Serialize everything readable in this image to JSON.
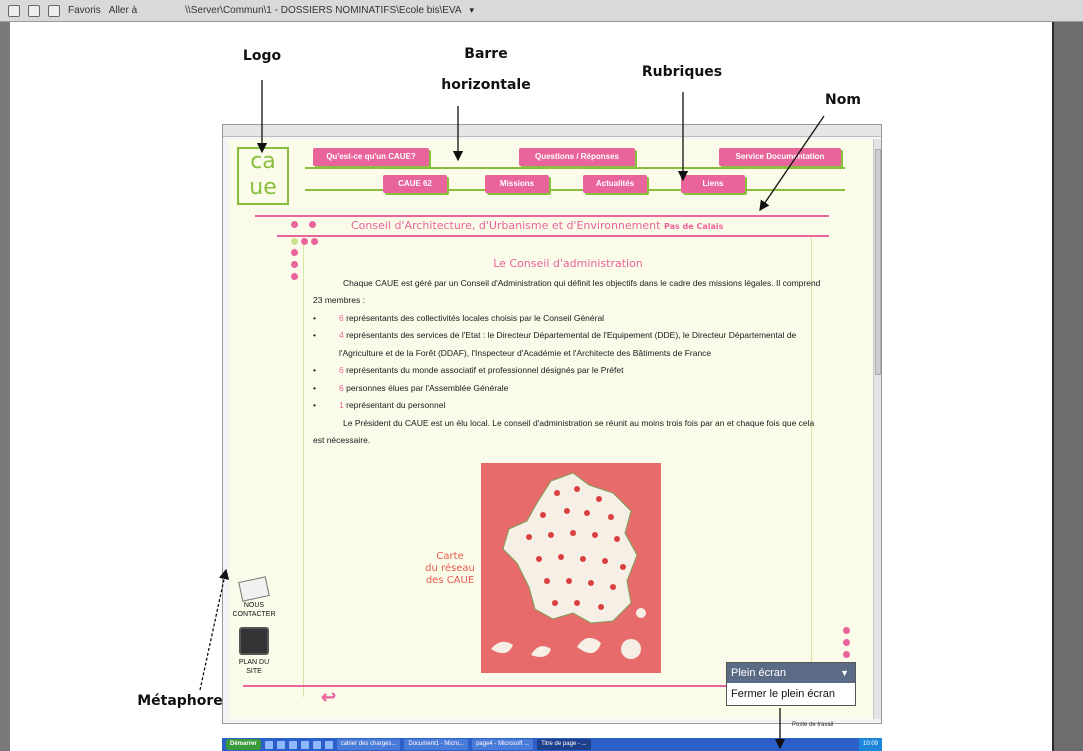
{
  "browser_bar": {
    "favorites_label": "Favoris",
    "go_label": "Aller à",
    "address": "\\\\Server\\Commun\\1 - DOSSIERS NOMINATIFS\\Ecole bis\\EVA"
  },
  "annotations": {
    "logo": "Logo",
    "bar_line1": "Barre",
    "bar_line2": "horizontale",
    "sections": "Rubriques",
    "name": "Nom",
    "metaphor": "Métaphore"
  },
  "screenshot": {
    "logo_text_top": "ca",
    "logo_text_bottom": "ue",
    "nav_row1": [
      "Qu'est-ce qu'un CAUE?",
      "Questions / Réponses",
      "Service Documentation"
    ],
    "nav_row2": [
      "CAUE 62",
      "Missions",
      "Actualités",
      "Liens"
    ],
    "site_name": "Conseil d'Architecture, d'Urbanisme et d'Environnement",
    "site_region": "Pas de Calais",
    "heading": "Le Conseil d'administration",
    "intro": "Chaque CAUE est géré par un Conseil d'Administration qui définit les objectifs dans le cadre des missions légales. Il comprend 23 membres :",
    "members": [
      {
        "num": "6",
        "text": "représentants des collectivités locales choisis par le Conseil Général"
      },
      {
        "num": "4",
        "text": "représentants des services de l'Etat : le Directeur Départemental de l'Equipement (DDE), le Directeur Départemental de l'Agriculture et de la Forêt (DDAF), l'Inspecteur d'Académie et l'Architecte des Bâtiments de France"
      },
      {
        "num": "6",
        "text": "représentants du monde associatif et professionnel désignés par le Préfet"
      },
      {
        "num": "6",
        "text": "personnes élues par l'Assemblée Générale"
      },
      {
        "num": "1",
        "text": "représentant du personnel"
      }
    ],
    "closing": "Le Président du CAUE est un élu local. Le conseil d'administration se réunit au moins trois fois par an et chaque fois que cela est nécessaire.",
    "map_caption_1": "Carte",
    "map_caption_2": "du réseau",
    "map_caption_3": "des CAUE",
    "contact_1": "NOUS",
    "contact_2": "CONTACTER",
    "plan_1": "PLAN DU",
    "plan_2": "SITE",
    "fullscreen_menu": {
      "title": "Plein écran",
      "close": "Fermer le plein écran"
    },
    "desktop_label": "Poste de travail",
    "taskbar": {
      "start": "Démarrer",
      "tasks": [
        "cahier des charges...",
        "Document1 - Micro...",
        "page4 - Microsoft ...",
        "Titre de page - ..."
      ],
      "clock": "10:09"
    }
  },
  "colors": {
    "accent_pink": "#e9649a",
    "accent_green": "#8abf3c",
    "map_red": "#e76b6b"
  }
}
